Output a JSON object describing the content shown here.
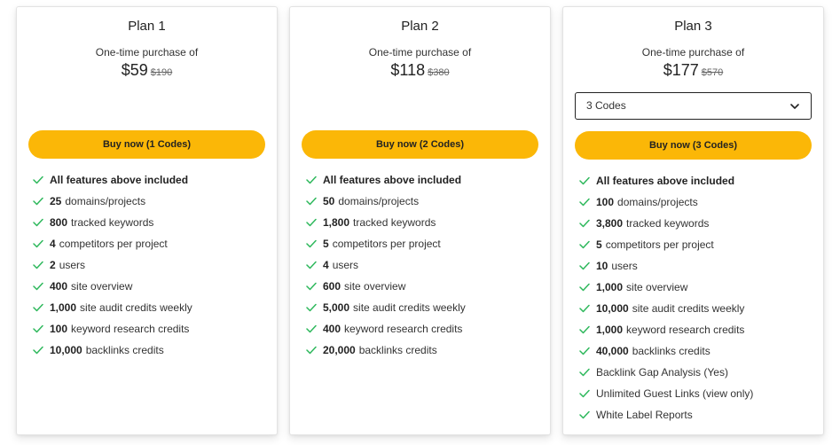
{
  "colors": {
    "accent": "#fbb707",
    "check": "#2eb85c"
  },
  "plans": [
    {
      "title": "Plan 1",
      "subtitle": "One-time purchase of",
      "price": "$59",
      "old_price": "$190",
      "buy_label": "Buy now (1 Codes)",
      "features": [
        {
          "bold": "All features above included",
          "text": ""
        },
        {
          "bold": "25",
          "text": "domains/projects"
        },
        {
          "bold": "800",
          "text": "tracked keywords"
        },
        {
          "bold": "4",
          "text": "competitors per project"
        },
        {
          "bold": "2",
          "text": "users"
        },
        {
          "bold": "400",
          "text": "site overview"
        },
        {
          "bold": "1,000",
          "text": "site audit credits weekly"
        },
        {
          "bold": "100",
          "text": "keyword research credits"
        },
        {
          "bold": "10,000",
          "text": "backlinks credits"
        }
      ]
    },
    {
      "title": "Plan 2",
      "subtitle": "One-time purchase of",
      "price": "$118",
      "old_price": "$380",
      "buy_label": "Buy now (2 Codes)",
      "features": [
        {
          "bold": "All features above included",
          "text": ""
        },
        {
          "bold": "50",
          "text": "domains/projects"
        },
        {
          "bold": "1,800",
          "text": "tracked keywords"
        },
        {
          "bold": "5",
          "text": "competitors per project"
        },
        {
          "bold": "4",
          "text": "users"
        },
        {
          "bold": "600",
          "text": "site overview"
        },
        {
          "bold": "5,000",
          "text": "site audit credits weekly"
        },
        {
          "bold": "400",
          "text": "keyword research credits"
        },
        {
          "bold": "20,000",
          "text": "backlinks credits"
        }
      ]
    },
    {
      "title": "Plan 3",
      "subtitle": "One-time purchase of",
      "price": "$177",
      "old_price": "$570",
      "select_value": "3 Codes",
      "buy_label": "Buy now (3 Codes)",
      "features": [
        {
          "bold": "All features above included",
          "text": ""
        },
        {
          "bold": "100",
          "text": "domains/projects"
        },
        {
          "bold": "3,800",
          "text": "tracked keywords"
        },
        {
          "bold": "5",
          "text": "competitors per project"
        },
        {
          "bold": "10",
          "text": "users"
        },
        {
          "bold": "1,000",
          "text": "site overview"
        },
        {
          "bold": "10,000",
          "text": "site audit credits weekly"
        },
        {
          "bold": "1,000",
          "text": "keyword research credits"
        },
        {
          "bold": "40,000",
          "text": "backlinks credits"
        },
        {
          "bold": "",
          "text": "Backlink Gap Analysis (Yes)"
        },
        {
          "bold": "",
          "text": "Unlimited Guest Links (view only)"
        },
        {
          "bold": "",
          "text": "White Label Reports"
        }
      ]
    }
  ]
}
